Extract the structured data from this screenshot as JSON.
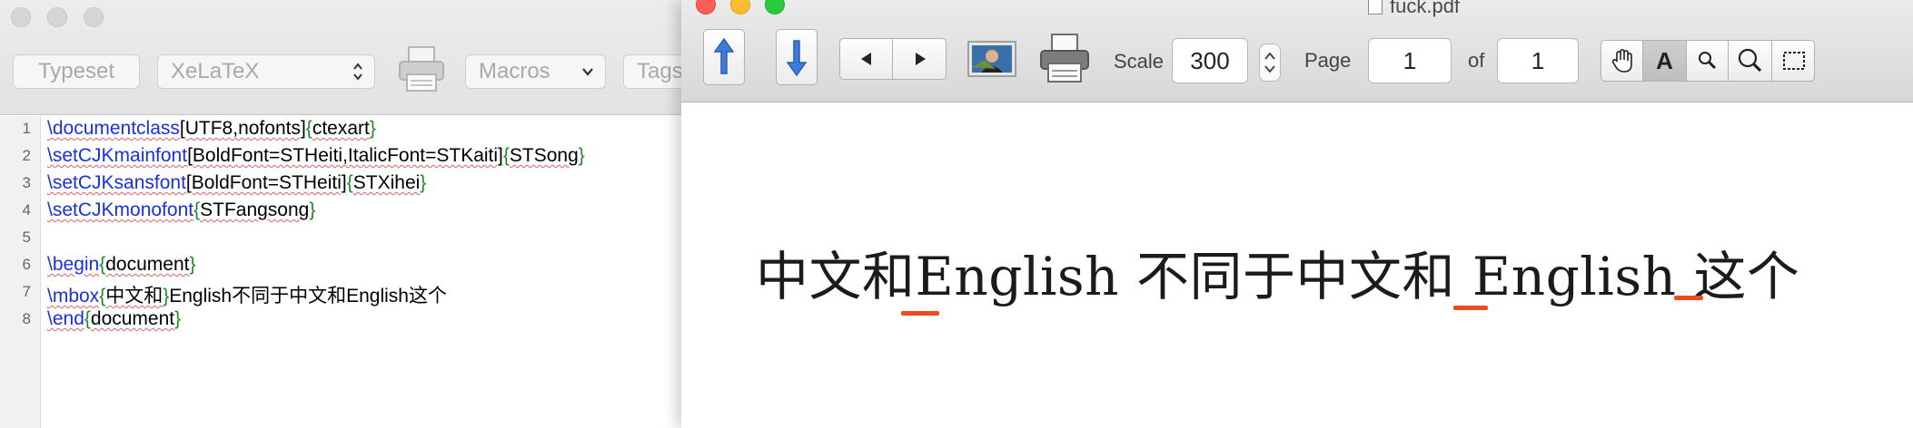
{
  "editor": {
    "toolbar": {
      "typeset_label": "Typeset",
      "engine_value": "XeLaTeX",
      "macros_label": "Macros",
      "tags_label": "Tags"
    },
    "lines": [
      {
        "num": "1",
        "cmd": "\\documentclass",
        "opt": "[UTF8,nofonts]",
        "o": "{",
        "arg": "ctexart",
        "c": "}"
      },
      {
        "num": "2",
        "cmd": "\\setCJKmainfont",
        "opt": "[BoldFont=STHeiti,ItalicFont=STKaiti]",
        "o": "{",
        "arg": "STSong",
        "c": "}"
      },
      {
        "num": "3",
        "cmd": "\\setCJKsansfont",
        "opt": "[BoldFont=STHeiti]",
        "o": "{",
        "arg": "STXihei",
        "c": "}"
      },
      {
        "num": "4",
        "cmd": "\\setCJKmonofont",
        "opt": "",
        "o": "{",
        "arg": "STFangsong",
        "c": "}"
      },
      {
        "num": "5"
      },
      {
        "num": "6",
        "cmd": "\\begin",
        "opt": "",
        "o": "{",
        "arg": "document",
        "c": "}"
      },
      {
        "num": "7",
        "cmd": "\\mbox",
        "opt": "",
        "o": "{",
        "arg": "中文和",
        "c": "}",
        "rest": "English不同于中文和English这个"
      },
      {
        "num": "8",
        "cmd": "\\end",
        "opt": "",
        "o": "{",
        "arg": "document",
        "c": "}"
      }
    ]
  },
  "viewer": {
    "title": "fuck.pdf",
    "scale_label": "Scale",
    "scale_value": "300",
    "page_label": "Page",
    "page_value": "1",
    "of_label": "of",
    "page_total": "1",
    "text_tool_label": "A",
    "pdf_text": "中文和English 不同于中文和 English 这个"
  },
  "colors": {
    "keyword": "#1a30e0",
    "brace": "#1f8a2a",
    "spelling_underline": "#e06060",
    "highlight_mark": "#ee4b1f",
    "close_light": "#fc5f57",
    "minimize_light": "#fdbc2e",
    "zoom_light": "#29c940"
  }
}
